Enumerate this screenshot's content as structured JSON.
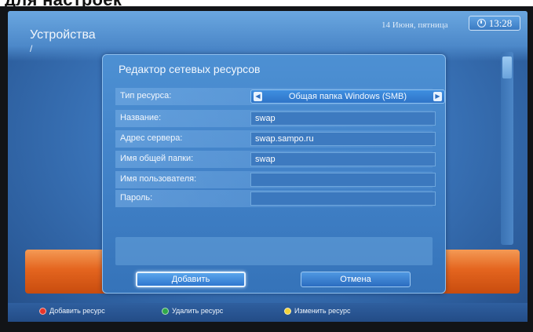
{
  "heading_fragment": "для настроек",
  "screen": {
    "title": "Устройства",
    "path": "/",
    "date": "14 Июня, пятница",
    "time": "13:28"
  },
  "dialog": {
    "title": "Редактор сетевых ресурсов",
    "resource_type": {
      "label": "Тип ресурса:",
      "value": "Общая папка Windows (SMB)"
    },
    "fields": [
      {
        "label": "Название:",
        "value": "swap"
      },
      {
        "label": "Адрес сервера:",
        "value": "swap.sampo.ru"
      },
      {
        "label": "Имя общей папки:",
        "value": "swap"
      },
      {
        "label": "Имя пользователя:",
        "value": ""
      },
      {
        "label": "Пароль:",
        "value": ""
      }
    ],
    "buttons": {
      "add": "Добавить",
      "cancel": "Отмена"
    }
  },
  "footer": {
    "hints": [
      {
        "color": "#e8352a",
        "label": "Добавить ресурс"
      },
      {
        "color": "#2fa84a",
        "label": "Удалить ресурс"
      },
      {
        "color": "#f2d33a",
        "label": "Изменить ресурс"
      }
    ]
  },
  "icons": {
    "clock": "clock-icon",
    "arrow_left": "arrow-left-icon",
    "arrow_right": "arrow-right-icon"
  },
  "colors": {
    "screen_blue": "#3a74b9",
    "accent_orange": "#e4651f",
    "focus_white": "#e6f2ff"
  }
}
